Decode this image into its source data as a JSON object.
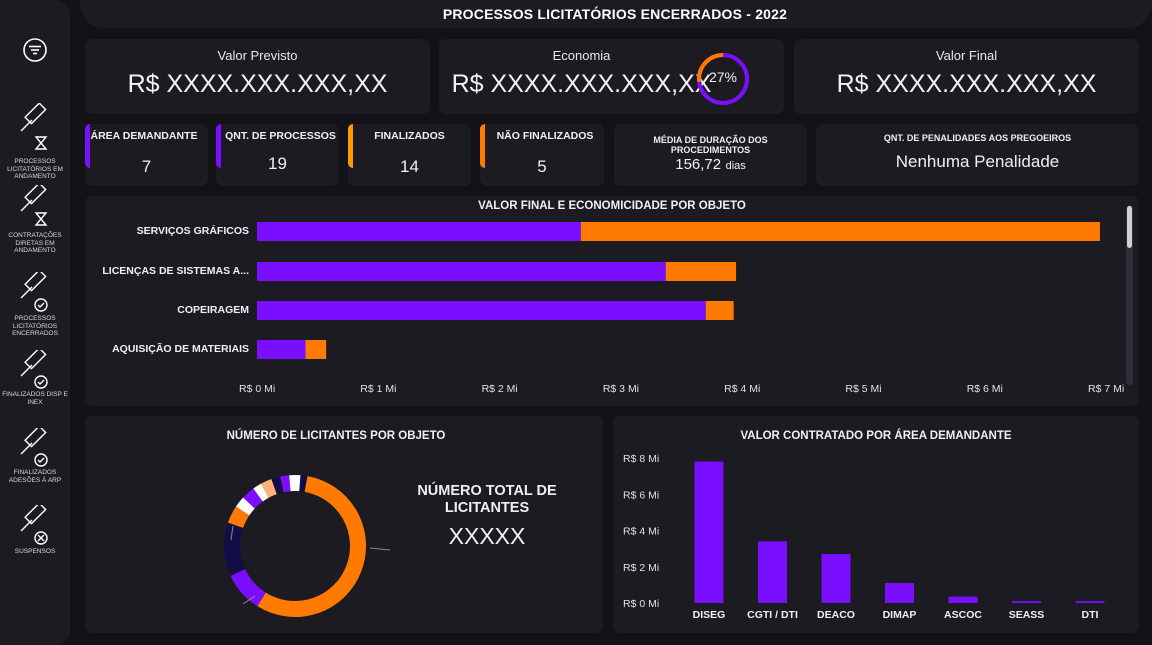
{
  "page": {
    "title": "PROCESSOS LICITATÓRIOS ENCERRADOS - 2022"
  },
  "sidebar": {
    "filter_icon": "filter-icon",
    "items": [
      {
        "label": "PROCESSOS LICITATÓRIOS EM ANDAMENTO",
        "icon": "gavel-hourglass-icon"
      },
      {
        "label": "CONTRATAÇÕES DIRETAS EM ANDAMENTO",
        "icon": "gavel-hourglass-icon"
      },
      {
        "label": "PROCESSOS LICITATÓRIOS ENCERRADOS",
        "icon": "gavel-check-icon"
      },
      {
        "label": "FINALIZADOS DISP E INEX",
        "icon": "gavel-check-icon"
      },
      {
        "label": "FINALIZADOS ADESÕES À ARP",
        "icon": "gavel-check-icon"
      },
      {
        "label": "SUSPENSOS",
        "icon": "gavel-x-icon"
      }
    ]
  },
  "kpis": {
    "valor_previsto": {
      "label": "Valor Previsto",
      "value": "R$ XXXX.XXX.XXX,XX"
    },
    "economia": {
      "label": "Economia",
      "value": "R$ XXXX.XXX.XXX,XX",
      "percent_label": "27%",
      "percent": 27
    },
    "valor_final": {
      "label": "Valor Final",
      "value": "R$ XXXX.XXX.XXX,XX"
    }
  },
  "stats": {
    "area": {
      "label": "ÁREA DEMANDANTE",
      "value": "7"
    },
    "qnt": {
      "label": "QNT. DE PROCESSOS",
      "value": "19"
    },
    "finalizados": {
      "label": "FINALIZADOS",
      "value": "14"
    },
    "nao_finalizados": {
      "label": "NÃO FINALIZADOS",
      "value": "5"
    },
    "media": {
      "label": "MÉDIA DE DURAÇÃO DOS PROCEDIMENTOS",
      "value": "156,72",
      "unit": "dias"
    },
    "penalidades": {
      "label": "QNT. DE PENALIDADES AOS PREGOEIROS",
      "value": "Nenhuma Penalidade"
    }
  },
  "colors": {
    "purple": "#7a0fff",
    "orange": "#ff7a00",
    "navy": "#120d46",
    "card": "#1c1b22"
  },
  "bar_chart": {
    "title": "VALOR FINAL E ECONOMICIDADE POR OBJETO",
    "ticks": [
      "R$ 0 Mi",
      "R$ 1 Mi",
      "R$ 2 Mi",
      "R$ 3 Mi",
      "R$ 4 Mi",
      "R$ 5 Mi",
      "R$ 6 Mi",
      "R$ 7 Mi"
    ]
  },
  "donut": {
    "title": "NÚMERO DE LICITANTES POR OBJETO",
    "total_label": "NÚMERO TOTAL DE LICITANTES",
    "total_value": "XXXXX"
  },
  "column_chart": {
    "title": "VALOR CONTRATADO POR ÁREA DEMANDANTE",
    "yticks": [
      "R$ 8 Mi",
      "R$ 6 Mi",
      "R$ 4 Mi",
      "R$ 2 Mi",
      "R$ 0 Mi"
    ]
  },
  "chart_data": [
    {
      "type": "bar",
      "title": "VALOR FINAL E ECONOMICIDADE POR OBJETO",
      "categories": [
        "SERVIÇOS GRÁFICOS",
        "LICENÇAS DE SISTEMAS A...",
        "COPEIRAGEM",
        "AQUISIÇÃO DE MATERIAIS"
      ],
      "stacked": true,
      "series": [
        {
          "color": "#7a0fff",
          "values": [
            2.67,
            3.37,
            3.7,
            0.4
          ]
        },
        {
          "color": "#ff7a00",
          "values": [
            4.28,
            0.58,
            0.23,
            0.17
          ]
        }
      ],
      "xlim": [
        0,
        7
      ]
    },
    {
      "type": "pie",
      "title": "NÚMERO DE LICITANTES POR OBJETO",
      "donut": true,
      "slices": [
        {
          "value": 55,
          "color": "#ff7a00"
        },
        {
          "value": 9,
          "color": "#7a0fff"
        },
        {
          "value": 6,
          "color": "#120d46"
        },
        {
          "value": 6,
          "color": "#120d46"
        },
        {
          "value": 4,
          "color": "#ff7a00"
        },
        {
          "value": 2.5,
          "color": "#ffffff"
        },
        {
          "value": 3,
          "color": "#7a0fff"
        },
        {
          "value": 2,
          "color": "#ffffff"
        },
        {
          "value": 2.5,
          "color": "#ffb27a"
        },
        {
          "value": 2,
          "color": "#120d46"
        },
        {
          "value": 2,
          "color": "#7a0fff"
        },
        {
          "value": 2.5,
          "color": "#ffffff"
        },
        {
          "value": 1.5,
          "color": "#120d46"
        }
      ]
    },
    {
      "type": "bar",
      "title": "VALOR CONTRATADO POR ÁREA DEMANDANTE",
      "categories": [
        "DISEG",
        "CGTI / DTI",
        "DEACO",
        "DIMAP",
        "ASCOC",
        "SEASS",
        "DTI"
      ],
      "values": [
        7.8,
        3.4,
        2.7,
        1.1,
        0.35,
        0.1,
        0.1
      ],
      "ylim": [
        0,
        8
      ],
      "color": "#7a0fff"
    }
  ]
}
